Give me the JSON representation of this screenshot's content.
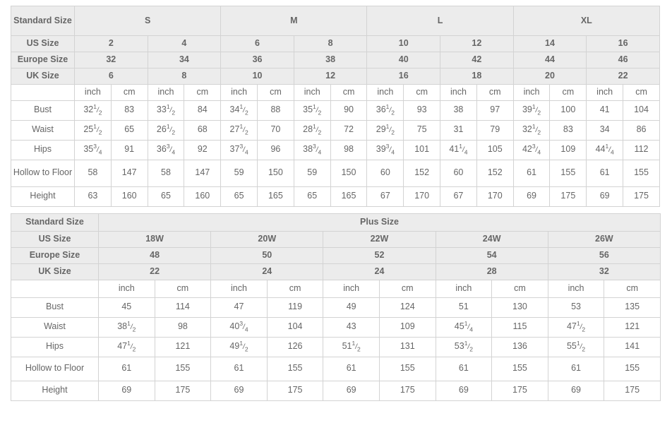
{
  "standard_table": {
    "corner_label": "Standard Size",
    "size_groups": [
      {
        "label": "S",
        "span": 4
      },
      {
        "label": "M",
        "span": 4
      },
      {
        "label": "L",
        "span": 4
      },
      {
        "label": "XL",
        "span": 4
      }
    ],
    "rows_sizes": [
      {
        "label": "US Size",
        "values": [
          "2",
          "4",
          "6",
          "8",
          "10",
          "12",
          "14",
          "16"
        ]
      },
      {
        "label": "Europe Size",
        "values": [
          "32",
          "34",
          "36",
          "38",
          "40",
          "42",
          "44",
          "46"
        ]
      },
      {
        "label": "UK Size",
        "values": [
          "6",
          "8",
          "10",
          "12",
          "16",
          "18",
          "20",
          "22"
        ]
      }
    ],
    "unit_row": {
      "label": "",
      "units": [
        "inch",
        "cm",
        "inch",
        "cm",
        "inch",
        "cm",
        "inch",
        "cm",
        "inch",
        "cm",
        "inch",
        "cm",
        "inch",
        "cm",
        "inch",
        "cm"
      ]
    },
    "measure_rows": [
      {
        "label": "Bust",
        "values": [
          {
            "whole": "32",
            "num": "1",
            "den": "2"
          },
          {
            "whole": "83"
          },
          {
            "whole": "33",
            "num": "1",
            "den": "2"
          },
          {
            "whole": "84"
          },
          {
            "whole": "34",
            "num": "1",
            "den": "2"
          },
          {
            "whole": "88"
          },
          {
            "whole": "35",
            "num": "1",
            "den": "2"
          },
          {
            "whole": "90"
          },
          {
            "whole": "36",
            "num": "1",
            "den": "2"
          },
          {
            "whole": "93"
          },
          {
            "whole": "38"
          },
          {
            "whole": "97"
          },
          {
            "whole": "39",
            "num": "1",
            "den": "2"
          },
          {
            "whole": "100"
          },
          {
            "whole": "41"
          },
          {
            "whole": "104"
          }
        ]
      },
      {
        "label": "Waist",
        "values": [
          {
            "whole": "25",
            "num": "1",
            "den": "2"
          },
          {
            "whole": "65"
          },
          {
            "whole": "26",
            "num": "1",
            "den": "2"
          },
          {
            "whole": "68"
          },
          {
            "whole": "27",
            "num": "1",
            "den": "2"
          },
          {
            "whole": "70"
          },
          {
            "whole": "28",
            "num": "1",
            "den": "2"
          },
          {
            "whole": "72"
          },
          {
            "whole": "29",
            "num": "1",
            "den": "2"
          },
          {
            "whole": "75"
          },
          {
            "whole": "31"
          },
          {
            "whole": "79"
          },
          {
            "whole": "32",
            "num": "1",
            "den": "2"
          },
          {
            "whole": "83"
          },
          {
            "whole": "34"
          },
          {
            "whole": "86"
          }
        ]
      },
      {
        "label": "Hips",
        "values": [
          {
            "whole": "35",
            "num": "3",
            "den": "4"
          },
          {
            "whole": "91"
          },
          {
            "whole": "36",
            "num": "3",
            "den": "4"
          },
          {
            "whole": "92"
          },
          {
            "whole": "37",
            "num": "3",
            "den": "4"
          },
          {
            "whole": "96"
          },
          {
            "whole": "38",
            "num": "3",
            "den": "4"
          },
          {
            "whole": "98"
          },
          {
            "whole": "39",
            "num": "3",
            "den": "4"
          },
          {
            "whole": "101"
          },
          {
            "whole": "41",
            "num": "1",
            "den": "4"
          },
          {
            "whole": "105"
          },
          {
            "whole": "42",
            "num": "3",
            "den": "4"
          },
          {
            "whole": "109"
          },
          {
            "whole": "44",
            "num": "1",
            "den": "4"
          },
          {
            "whole": "112"
          }
        ]
      },
      {
        "label": "Hollow to Floor",
        "values": [
          {
            "whole": "58"
          },
          {
            "whole": "147"
          },
          {
            "whole": "58"
          },
          {
            "whole": "147"
          },
          {
            "whole": "59"
          },
          {
            "whole": "150"
          },
          {
            "whole": "59"
          },
          {
            "whole": "150"
          },
          {
            "whole": "60"
          },
          {
            "whole": "152"
          },
          {
            "whole": "60"
          },
          {
            "whole": "152"
          },
          {
            "whole": "61"
          },
          {
            "whole": "155"
          },
          {
            "whole": "61"
          },
          {
            "whole": "155"
          }
        ]
      },
      {
        "label": "Height",
        "values": [
          {
            "whole": "63"
          },
          {
            "whole": "160"
          },
          {
            "whole": "65"
          },
          {
            "whole": "160"
          },
          {
            "whole": "65"
          },
          {
            "whole": "165"
          },
          {
            "whole": "65"
          },
          {
            "whole": "165"
          },
          {
            "whole": "67"
          },
          {
            "whole": "170"
          },
          {
            "whole": "67"
          },
          {
            "whole": "170"
          },
          {
            "whole": "69"
          },
          {
            "whole": "175"
          },
          {
            "whole": "69"
          },
          {
            "whole": "175"
          }
        ]
      }
    ]
  },
  "plus_table": {
    "corner_label": "Standard Size",
    "group_label": "Plus Size",
    "rows_sizes": [
      {
        "label": "US Size",
        "values": [
          "18W",
          "20W",
          "22W",
          "24W",
          "26W"
        ]
      },
      {
        "label": "Europe Size",
        "values": [
          "48",
          "50",
          "52",
          "54",
          "56"
        ]
      },
      {
        "label": "UK Size",
        "values": [
          "22",
          "24",
          "24",
          "28",
          "32"
        ]
      }
    ],
    "unit_row": {
      "label": "",
      "units": [
        "inch",
        "cm",
        "inch",
        "cm",
        "inch",
        "cm",
        "inch",
        "cm",
        "inch",
        "cm"
      ]
    },
    "measure_rows": [
      {
        "label": "Bust",
        "values": [
          {
            "whole": "45"
          },
          {
            "whole": "114"
          },
          {
            "whole": "47"
          },
          {
            "whole": "119"
          },
          {
            "whole": "49"
          },
          {
            "whole": "124"
          },
          {
            "whole": "51"
          },
          {
            "whole": "130"
          },
          {
            "whole": "53"
          },
          {
            "whole": "135"
          }
        ]
      },
      {
        "label": "Waist",
        "values": [
          {
            "whole": "38",
            "num": "1",
            "den": "2"
          },
          {
            "whole": "98"
          },
          {
            "whole": "40",
            "num": "3",
            "den": "4"
          },
          {
            "whole": "104"
          },
          {
            "whole": "43"
          },
          {
            "whole": "109"
          },
          {
            "whole": "45",
            "num": "1",
            "den": "4"
          },
          {
            "whole": "115"
          },
          {
            "whole": "47",
            "num": "1",
            "den": "2"
          },
          {
            "whole": "121"
          }
        ]
      },
      {
        "label": "Hips",
        "values": [
          {
            "whole": "47",
            "num": "1",
            "den": "2"
          },
          {
            "whole": "121"
          },
          {
            "whole": "49",
            "num": "1",
            "den": "2"
          },
          {
            "whole": "126"
          },
          {
            "whole": "51",
            "num": "1",
            "den": "2"
          },
          {
            "whole": "131"
          },
          {
            "whole": "53",
            "num": "1",
            "den": "2"
          },
          {
            "whole": "136"
          },
          {
            "whole": "55",
            "num": "1",
            "den": "2"
          },
          {
            "whole": "141"
          }
        ]
      },
      {
        "label": "Hollow to Floor",
        "values": [
          {
            "whole": "61"
          },
          {
            "whole": "155"
          },
          {
            "whole": "61"
          },
          {
            "whole": "155"
          },
          {
            "whole": "61"
          },
          {
            "whole": "155"
          },
          {
            "whole": "61"
          },
          {
            "whole": "155"
          },
          {
            "whole": "61"
          },
          {
            "whole": "155"
          }
        ]
      },
      {
        "label": "Height",
        "values": [
          {
            "whole": "69"
          },
          {
            "whole": "175"
          },
          {
            "whole": "69"
          },
          {
            "whole": "175"
          },
          {
            "whole": "69"
          },
          {
            "whole": "175"
          },
          {
            "whole": "69"
          },
          {
            "whole": "175"
          },
          {
            "whole": "69"
          },
          {
            "whole": "175"
          }
        ]
      }
    ]
  },
  "colors": {
    "header_bg": "#ececec",
    "border": "#d3d3d3",
    "text_dark": "#1a1a1a",
    "text_body": "#666666",
    "page_bg": "#ffffff"
  }
}
